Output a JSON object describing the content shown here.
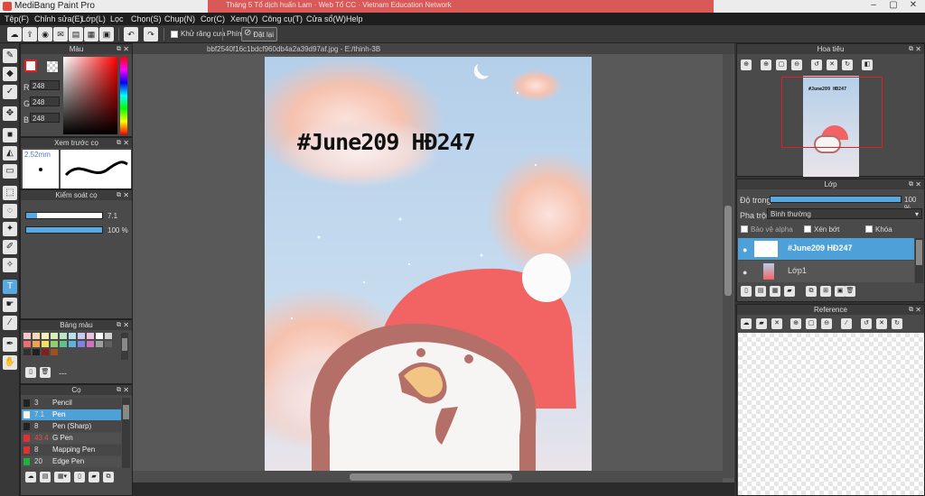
{
  "app": {
    "title": "MediBang Paint Pro",
    "bg_tab_text": "Tháng 5 Tổ dịch huấn Lam  ·  Web Tổ CC  ·  Vietnam Education Network"
  },
  "menu": [
    "Tệp(F)",
    "Chỉnh sửa(E)",
    "Lớp(L)",
    "Lọc",
    "Chọn(S)",
    "Chụp(N)",
    "Cor(C)",
    "Xem(V)",
    "Công cụ(T)",
    "Cửa sổ(W)",
    "Help"
  ],
  "toolbar": {
    "antialias_label": "Khử răng cưa",
    "key_label": "Phím",
    "reset_label": "Đặt lại"
  },
  "doc": {
    "tab_title": "bbf2540f16c1bdcf960db4a2a39d97af.jpg - E:/thinh-3B",
    "art_text": "#June209 HĐ247"
  },
  "color_panel": {
    "title": "Màu",
    "r": "248",
    "g": "248",
    "b": "248",
    "r_label": "R",
    "g_label": "G",
    "b_label": "B",
    "primary": "#f8f8f8",
    "accent": "#e02020"
  },
  "brush_preview": {
    "title": "Xem trước cọ",
    "size": "2.52mm"
  },
  "brush_control": {
    "title": "Kiểm soát cọ",
    "size_value": "7.1",
    "opacity_value": "100 %"
  },
  "palette": {
    "title": "Bảng màu",
    "name": "---",
    "colors": [
      "#f7c8c8",
      "#f7d8b8",
      "#f8f0b8",
      "#d8f0b8",
      "#b8e8c8",
      "#b8e0f0",
      "#c8c8f0",
      "#f0c0e0",
      "#ffffff",
      "#d0d0d0",
      "#e87070",
      "#f0a050",
      "#f0e060",
      "#90d070",
      "#60c090",
      "#60b0e0",
      "#8080e0",
      "#d070c0",
      "#a0a0a0",
      "#606060",
      "#303030",
      "#202020",
      "#802020",
      "#a05020"
    ]
  },
  "brush_panel": {
    "title": "Cọ",
    "items": [
      {
        "size": "3",
        "name": "Pencil",
        "color": "#222222"
      },
      {
        "size": "7.1",
        "name": "Pen",
        "color": "#f8f8f8"
      },
      {
        "size": "8",
        "name": "Pen (Sharp)",
        "color": "#222222"
      },
      {
        "size": "43.4",
        "name": "G Pen",
        "color": "#e03030"
      },
      {
        "size": "8",
        "name": "Mapping Pen",
        "color": "#e03030"
      },
      {
        "size": "20",
        "name": "Edge Pen",
        "color": "#20b040"
      }
    ]
  },
  "navigator": {
    "title": "Hoa tiêu"
  },
  "layers": {
    "title": "Lớp",
    "opacity_label": "Độ trong",
    "opacity_value": "100 %",
    "blend_label": "Pha trộn",
    "blend_value": "Bình thường",
    "protect_alpha": "Bảo vệ alpha",
    "clip": "Xén bớt",
    "lock": "Khóa",
    "items": [
      {
        "name": "#June209 HĐ247",
        "selected": true
      },
      {
        "name": "Lớp1",
        "selected": false
      }
    ]
  },
  "reference": {
    "title": "Reference"
  }
}
